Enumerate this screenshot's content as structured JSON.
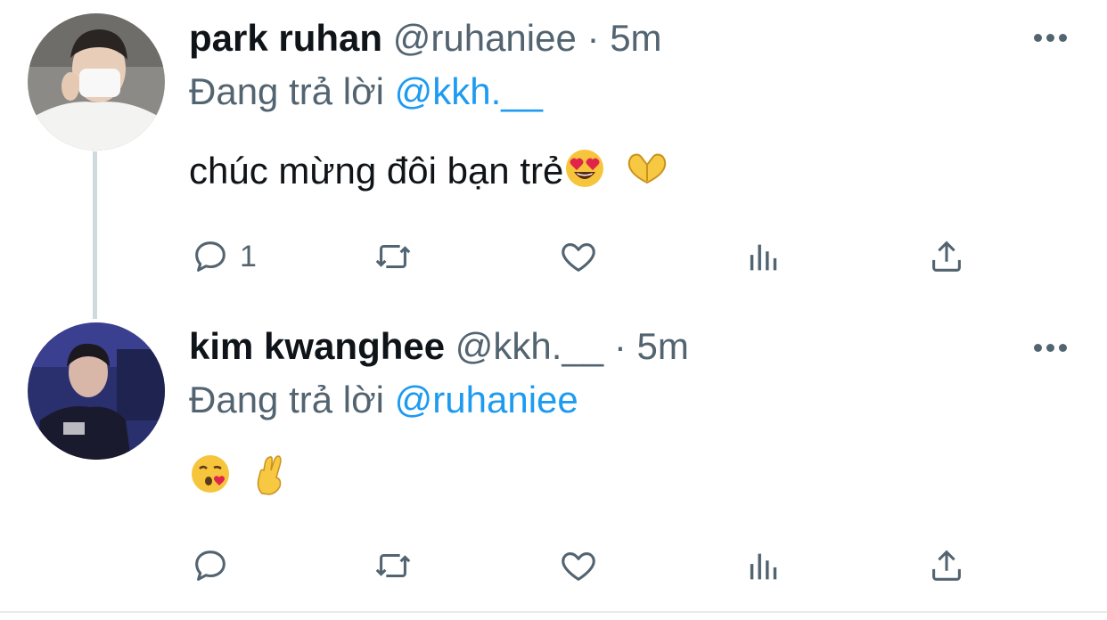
{
  "tweets": [
    {
      "name": "park ruhan",
      "handle": "@ruhaniee",
      "separator": "·",
      "time": "5m",
      "reply_prefix": "Đang trả lời",
      "reply_to": "@kkh.__",
      "text": "chúc mừng đôi bạn trẻ",
      "emojis": [
        "heart-eyes-emoji",
        "heart-hands-emoji"
      ],
      "reply_count": "1"
    },
    {
      "name": "kim kwanghee",
      "handle": "@kkh.__",
      "separator": "·",
      "time": "5m",
      "reply_prefix": "Đang trả lời",
      "reply_to": "@ruhaniee",
      "text": "",
      "emojis": [
        "kissing-heart-emoji",
        "crossed-fingers-emoji"
      ],
      "reply_count": ""
    }
  ],
  "colors": {
    "text": "#0f1419",
    "secondary": "#536471",
    "link": "#1d9bf0",
    "thread_line": "#cfd9de"
  },
  "icons": [
    "reply-icon",
    "retweet-icon",
    "like-icon",
    "views-icon",
    "share-icon",
    "more-icon"
  ]
}
